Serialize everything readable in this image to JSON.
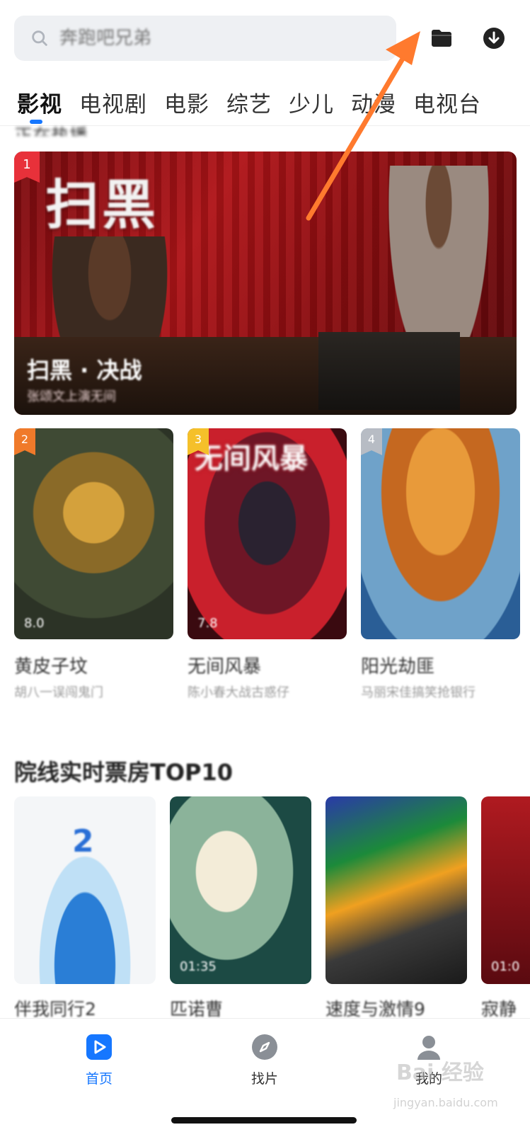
{
  "search": {
    "placeholder": "奔跑吧兄弟"
  },
  "header": {
    "folder_icon": "folder-icon",
    "download_icon": "download-icon"
  },
  "tabs": [
    {
      "label": "影视",
      "active": true
    },
    {
      "label": "电视剧"
    },
    {
      "label": "电影"
    },
    {
      "label": "综艺"
    },
    {
      "label": "少儿"
    },
    {
      "label": "动漫"
    },
    {
      "label": "电视台"
    }
  ],
  "section_peek": "正在热播",
  "hero": {
    "rank": "1",
    "logo": "扫黑",
    "title": "扫黑 · 决战",
    "subtitle": "张颂文上演无间",
    "accent": "#e8313a"
  },
  "posters": [
    {
      "rank": "2",
      "rank_color": "#f07a2a",
      "score": "8.0",
      "title": "黄皮子坟",
      "subtitle": "胡八一误闯鬼门"
    },
    {
      "rank": "3",
      "rank_color": "#f5c02a",
      "score": "7.8",
      "title": "无间风暴",
      "subtitle": "陈小春大战古惑仔",
      "logo": "无间风暴"
    },
    {
      "rank": "4",
      "rank_color": "#b7bcc4",
      "score": "",
      "title": "阳光劫匪",
      "subtitle": "马丽宋佳搞笑抢银行"
    }
  ],
  "box_office": {
    "title": "院线实时票房TOP10",
    "items": [
      {
        "title": "伴我同行2",
        "time": "",
        "num": "2"
      },
      {
        "title": "匹诺曹",
        "time": "01:35"
      },
      {
        "title": "速度与激情9",
        "time": ""
      },
      {
        "title": "寂静",
        "time": "01:0"
      }
    ]
  },
  "bottom_nav": [
    {
      "label": "首页",
      "icon": "play-icon",
      "active": true
    },
    {
      "label": "找片",
      "icon": "compass-icon"
    },
    {
      "label": "我的",
      "icon": "user-icon"
    }
  ],
  "watermark": {
    "main": "Bai 经验",
    "sub": "jingyan.baidu.com"
  },
  "colors": {
    "accent": "#1677ff",
    "annotation": "#ff7a2e"
  }
}
